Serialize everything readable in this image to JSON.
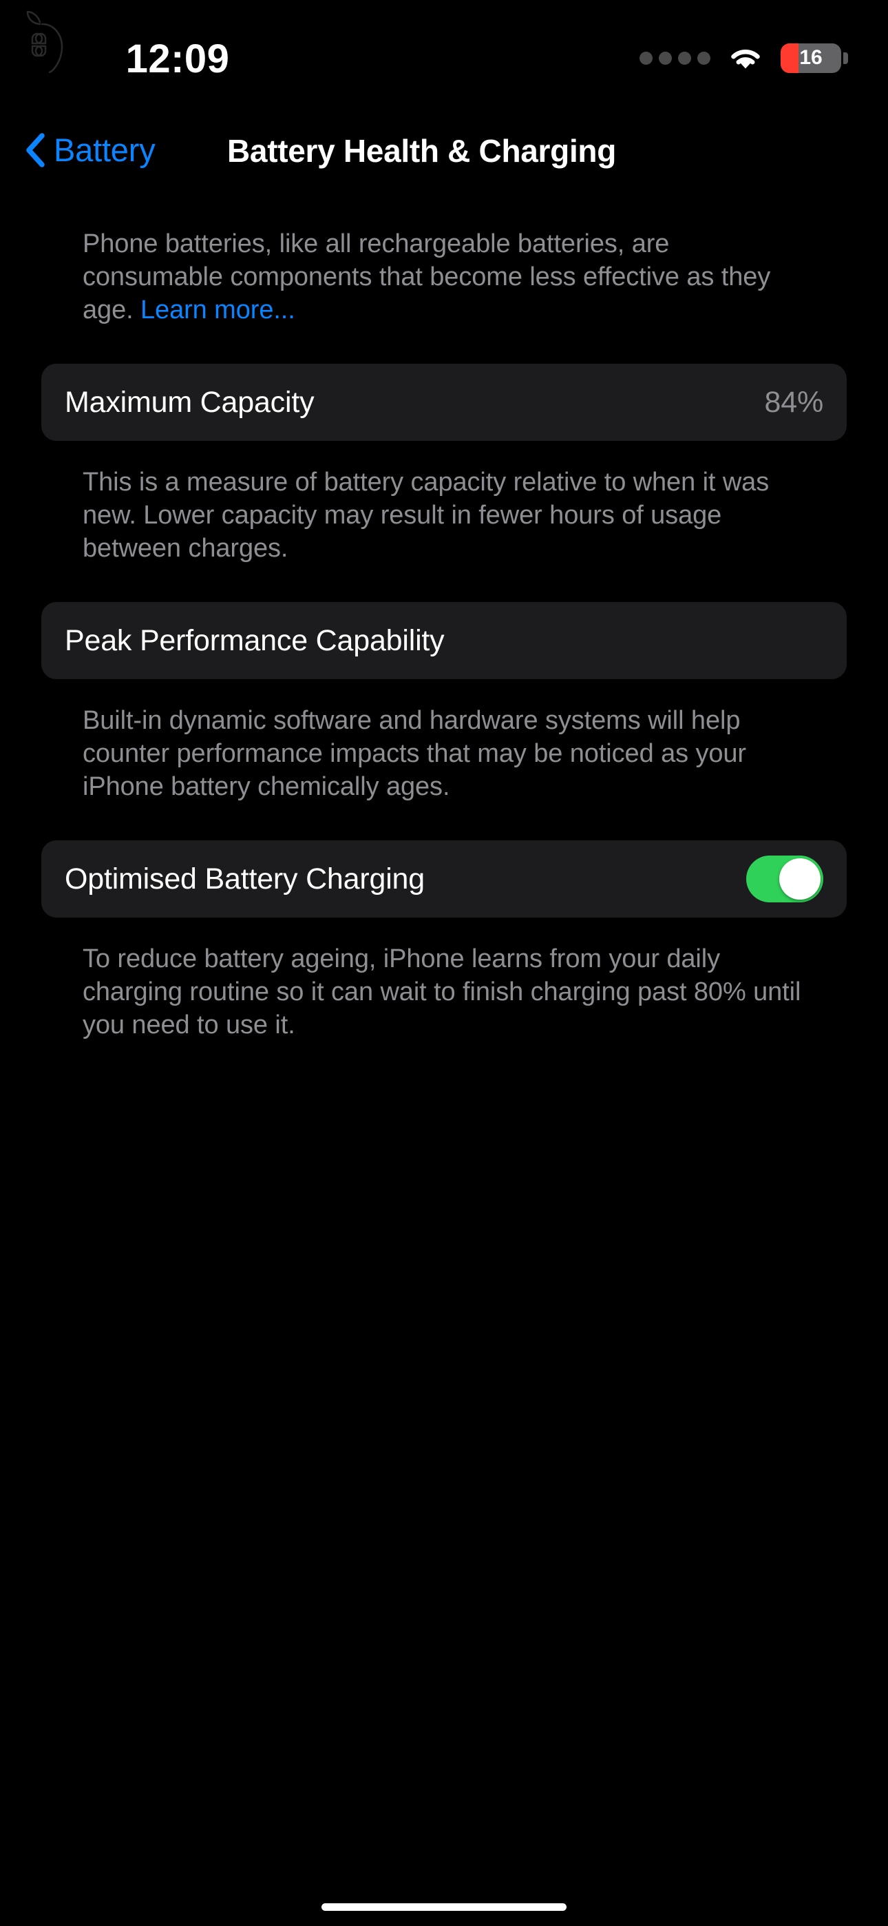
{
  "status_bar": {
    "time": "12:09",
    "cellular_icon": "cellular-dots-icon",
    "wifi_icon": "wifi-icon",
    "battery_icon": "battery-icon",
    "battery_level": "16",
    "battery_percent": 16,
    "battery_low_color": "#ff3b30",
    "battery_body_color": "#636366"
  },
  "nav": {
    "back_icon": "chevron-left-icon",
    "back_label": "Battery",
    "title": "Battery Health & Charging",
    "accent_color": "#0a84ff"
  },
  "watermark": {
    "icon": "apple-command-watermark-icon"
  },
  "intro": {
    "text": "Phone batteries, like all rechargeable batteries, are consumable components that become less effective as they age. ",
    "link_text": "Learn more..."
  },
  "sections": [
    {
      "row_name": "maximum-capacity",
      "title": "Maximum Capacity",
      "value": "84%",
      "footer": "This is a measure of battery capacity relative to when it was new. Lower capacity may result in fewer hours of usage between charges."
    },
    {
      "row_name": "peak-performance-capability",
      "title": "Peak Performance Capability",
      "value": "",
      "footer": "Built-in dynamic software and hardware systems will help counter performance impacts that may be noticed as your iPhone battery chemically ages."
    },
    {
      "row_name": "optimised-battery-charging",
      "title": "Optimised Battery Charging",
      "toggle_state": "on",
      "toggle_color": "#30d158",
      "footer": "To reduce battery ageing, iPhone learns from your daily charging routine so it can wait to finish charging past 80% until you need to use it."
    }
  ],
  "home_indicator": {
    "label": "home-indicator"
  }
}
